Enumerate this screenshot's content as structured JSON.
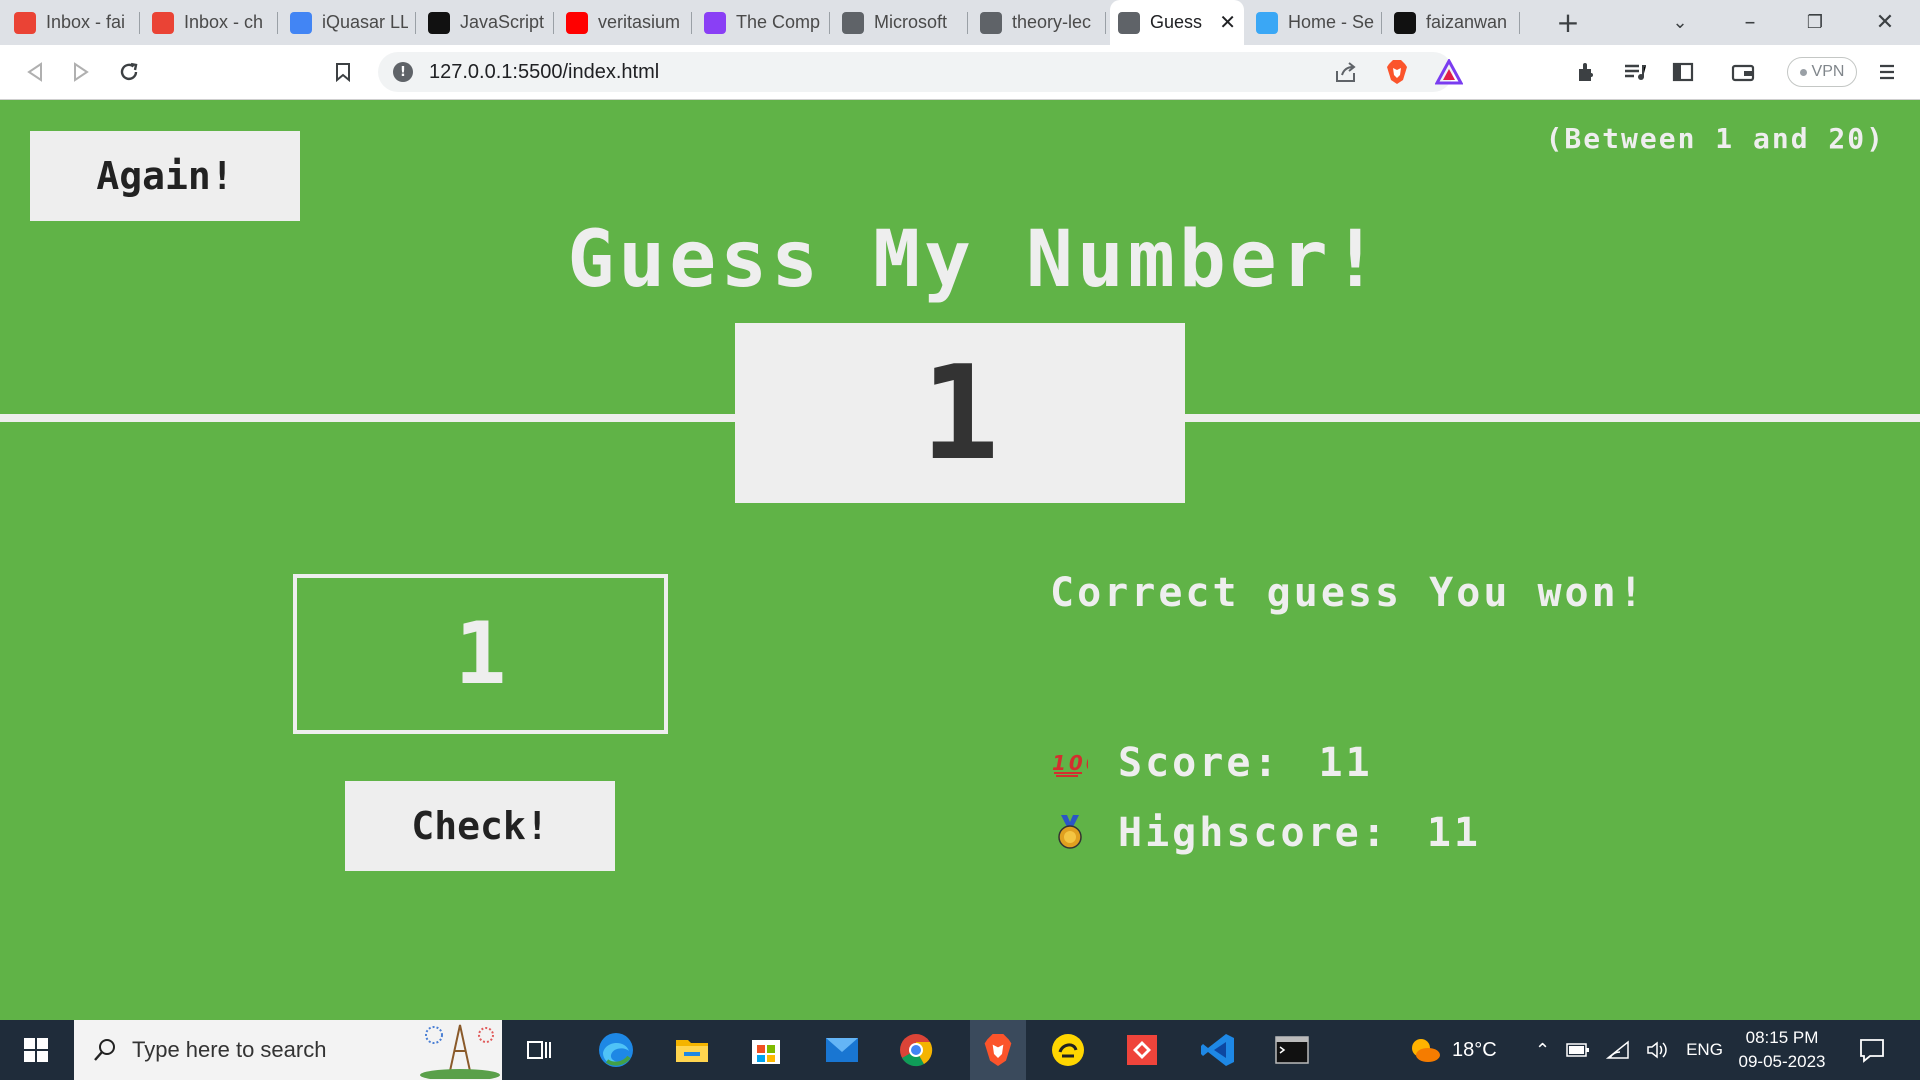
{
  "browser": {
    "tabs": [
      {
        "label": "Inbox - fai",
        "icon": "gmail-icon",
        "color": "#ea4335"
      },
      {
        "label": "Inbox - ch",
        "icon": "gmail-icon",
        "color": "#ea4335"
      },
      {
        "label": "iQuasar LL",
        "icon": "calendar-icon",
        "color": "#4285f4"
      },
      {
        "label": "JavaScript",
        "icon": "js-icon",
        "color": "#111111"
      },
      {
        "label": "veritasium",
        "icon": "youtube-icon",
        "color": "#ff0000"
      },
      {
        "label": "The Comp",
        "icon": "ublock-icon",
        "color": "#8a3ff5"
      },
      {
        "label": "Microsoft",
        "icon": "globe-icon",
        "color": "#5f6368"
      },
      {
        "label": "theory-lec",
        "icon": "globe-icon",
        "color": "#5f6368"
      },
      {
        "label": "Guess",
        "icon": "globe-icon",
        "color": "#5f6368",
        "active": true
      },
      {
        "label": "Home - Se",
        "icon": "site-icon",
        "color": "#3aa7f5"
      },
      {
        "label": "faizanwan",
        "icon": "github-icon",
        "color": "#111111"
      }
    ],
    "url": "127.0.0.1:5500/index.html",
    "vpn_label": "VPN"
  },
  "game": {
    "again_label": "Again!",
    "range_text": "(Between 1 and 20)",
    "title": "Guess My Number!",
    "secret_number": "1",
    "guess_value": "1",
    "check_label": "Check!",
    "message": "Correct guess You won!",
    "score_label": "Score:",
    "score_value": "11",
    "highscore_label": "Highscore:",
    "highscore_value": "11",
    "colors": {
      "background": "#60b347",
      "light": "#eeeeee",
      "dark": "#333333"
    }
  },
  "taskbar": {
    "search_placeholder": "Type here to search",
    "weather": "18°C",
    "language": "ENG",
    "time": "08:15 PM",
    "date": "09-05-2023"
  }
}
